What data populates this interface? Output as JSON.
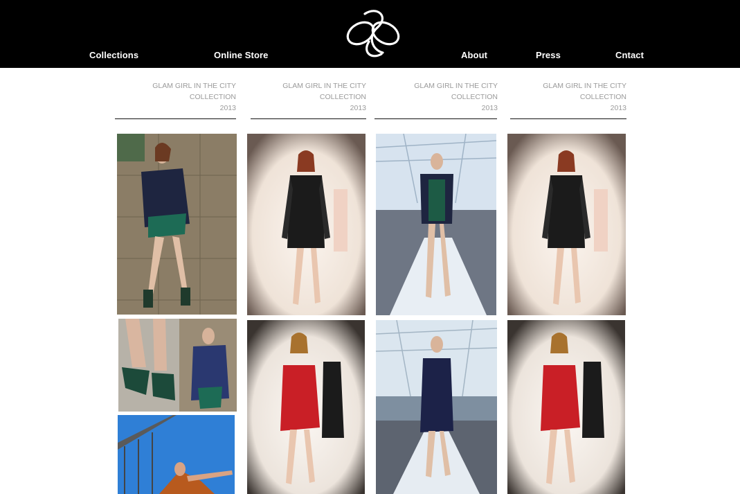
{
  "nav": {
    "collections": "Collections",
    "online_store": "Online Store",
    "about": "About",
    "press": "Press",
    "contact": "Cntact"
  },
  "brand": {
    "logo_icon": "knot-logo-icon"
  },
  "columns": [
    {
      "line1": "GLAM GIRL IN THE CITY",
      "line2": "COLLECTION",
      "line3": "2013"
    },
    {
      "line1": "GLAM GIRL IN THE CITY",
      "line2": "COLLECTION",
      "line3": "2013"
    },
    {
      "line1": "GLAM GIRL IN THE CITY",
      "line2": "COLLECTION",
      "line3": "2013"
    },
    {
      "line1": "GLAM GIRL IN THE CITY",
      "line2": "COLLECTION",
      "line3": "2013"
    }
  ],
  "colors": {
    "header_bg": "#000000",
    "caption_gray": "#9a9a9a",
    "dress_red": "#c91f26",
    "jacket_navy": "#1e2540"
  }
}
